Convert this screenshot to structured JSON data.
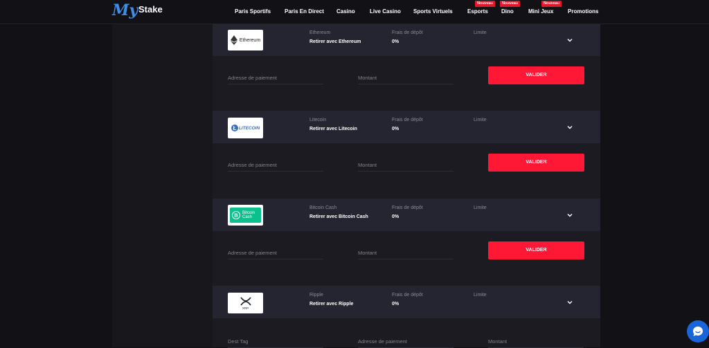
{
  "header": {
    "logo_my": "My",
    "logo_stake": "Stake",
    "nav": [
      {
        "label": "Paris Sportifs",
        "badge": ""
      },
      {
        "label": "Paris En Direct",
        "badge": ""
      },
      {
        "label": "Casino",
        "badge": ""
      },
      {
        "label": "Live Casino",
        "badge": ""
      },
      {
        "label": "Sports Virtuels",
        "badge": ""
      },
      {
        "label": "Esports",
        "badge": "Nouveau"
      },
      {
        "label": "Dino",
        "badge": "Nouveau"
      },
      {
        "label": "Mini Jeux",
        "badge": "Nouveau"
      },
      {
        "label": "Promotions",
        "badge": ""
      }
    ]
  },
  "columns": {
    "fee_label": "Frais de dépôt",
    "limit_label": "Limite"
  },
  "methods": [
    {
      "logo_text": "Ethereum",
      "name": "Ethereum",
      "action": "Retirer avec Ethereum",
      "fee": "0%",
      "fields": [
        "Adresse de paiement",
        "Montant"
      ],
      "button": "VALIDER"
    },
    {
      "logo_text": "LITECOIN",
      "name": "Litecoin",
      "action": "Retirer avec Litecoin",
      "fee": "0%",
      "fields": [
        "Adresse de paiement",
        "Montant"
      ],
      "button": "VALIDER"
    },
    {
      "logo_text": "Bitcoin Cash",
      "name": "Bitcoin Cash",
      "action": "Retirer avec Bitcoin Cash",
      "fee": "0%",
      "fields": [
        "Adresse de paiement",
        "Montant"
      ],
      "button": "VALIDER"
    },
    {
      "logo_text": "XRP",
      "name": "Ripple",
      "action": "Retirer avec Ripple",
      "fee": "0%",
      "fields": [
        "Dest Tag",
        "Adresse de paiement",
        "Montant"
      ],
      "button": ""
    }
  ],
  "colors": {
    "accent": "#ff1736",
    "badge": "#e0192d",
    "logo_blue": "#3e8ee8",
    "chat": "#1a66d8"
  }
}
